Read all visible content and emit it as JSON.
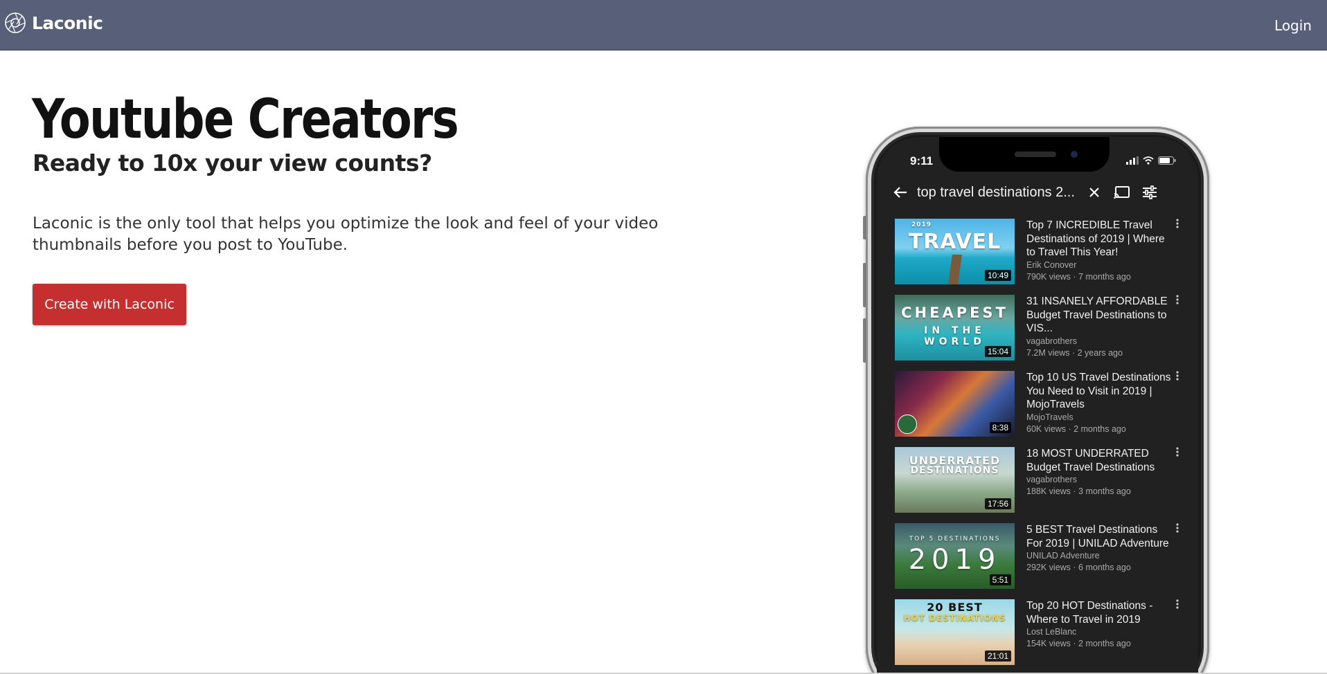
{
  "navbar": {
    "brand": "Laconic",
    "login_label": "Login",
    "bg_color": "#585f78"
  },
  "hero": {
    "title": "Youtube Creators",
    "subtitle": "Ready to 10x your view counts?",
    "description": "Laconic is the only tool that helps you optimize the look and feel of your video thumbnails before you post to YouTube.",
    "cta_label": "Create with Laconic",
    "cta_color": "#c62f2f"
  },
  "phone": {
    "time": "9:11",
    "search_query": "top travel destinations 2...",
    "results": [
      {
        "thumb_text": "TRAVEL",
        "thumb_small": "2019",
        "duration": "10:49",
        "title": "Top 7 INCREDIBLE Travel Destinations of 2019 | Where to Travel This Year!",
        "channel": "Erik Conover",
        "stats": "790K views · 7 months ago"
      },
      {
        "thumb_text": "CHEAPEST",
        "thumb_small": "IN THE WORLD",
        "duration": "15:04",
        "title": "31 INSANELY AFFORDABLE Budget Travel Destinations to VIS...",
        "channel": "vagabrothers",
        "stats": "7.2M views · 2 years ago"
      },
      {
        "thumb_text": "",
        "thumb_small": "",
        "duration": "8:38",
        "title": "Top 10 US Travel Destinations You Need to Visit in 2019 | MojoTravels",
        "channel": "MojoTravels",
        "stats": "60K views · 2 months ago"
      },
      {
        "thumb_text": "UNDERRATED",
        "thumb_small": "DESTINATIONS",
        "duration": "17:56",
        "title": "18 MOST UNDERRATED Budget Travel Destinations",
        "channel": "vagabrothers",
        "stats": "188K views · 3 months ago"
      },
      {
        "thumb_text": "2019",
        "thumb_small": "TOP 5 DESTINATIONS",
        "duration": "5:51",
        "title": "5 BEST Travel Destinations For 2019 | UNILAD Adventure",
        "channel": "UNILAD Adventure",
        "stats": "292K views · 6 months ago"
      },
      {
        "thumb_text": "20 BEST",
        "thumb_small": "HOT DESTINATIONS",
        "duration": "21:01",
        "title": "Top 20 HOT Destinations - Where to Travel in 2019",
        "channel": "Lost LeBlanc",
        "stats": "154K views · 2 months ago"
      }
    ]
  }
}
